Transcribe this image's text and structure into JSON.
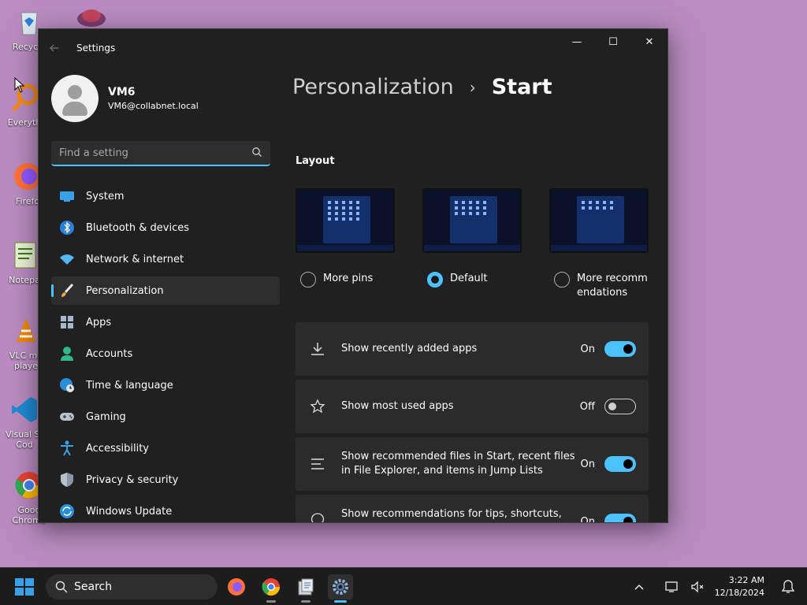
{
  "desktop": {
    "icons": [
      {
        "label": "Recycle",
        "name": "recycle-bin"
      },
      {
        "label": "Everyth",
        "name": "everything"
      },
      {
        "label": "Firefo",
        "name": "firefox"
      },
      {
        "label": "Notepa",
        "name": "notepad"
      },
      {
        "label": "VLC ma",
        "name": "vlc"
      },
      {
        "label": "Visual St",
        "name": "vscode"
      },
      {
        "label": "Goog",
        "name": "chrome"
      }
    ],
    "extra_labels": {
      "vlc_line2": "playe",
      "vscode_line2": "Cod",
      "chrome_line2": "Chrome"
    }
  },
  "window": {
    "title": "Settings",
    "back_icon": "arrow-left-icon",
    "controls": {
      "minimize": "—",
      "maximize": "☐",
      "close": "✕"
    }
  },
  "profile": {
    "name": "VM6",
    "email": "VM6@collabnet.local"
  },
  "search": {
    "placeholder": "Find a setting"
  },
  "nav": {
    "items": [
      {
        "label": "System",
        "icon": "monitor-icon"
      },
      {
        "label": "Bluetooth & devices",
        "icon": "bluetooth-icon"
      },
      {
        "label": "Network & internet",
        "icon": "wifi-icon"
      },
      {
        "label": "Personalization",
        "icon": "brush-icon",
        "active": true
      },
      {
        "label": "Apps",
        "icon": "apps-icon"
      },
      {
        "label": "Accounts",
        "icon": "person-icon"
      },
      {
        "label": "Time & language",
        "icon": "globe-clock-icon"
      },
      {
        "label": "Gaming",
        "icon": "gamepad-icon"
      },
      {
        "label": "Accessibility",
        "icon": "accessibility-icon"
      },
      {
        "label": "Privacy & security",
        "icon": "shield-icon"
      },
      {
        "label": "Windows Update",
        "icon": "update-icon"
      }
    ]
  },
  "content": {
    "breadcrumb_parent": "Personalization",
    "breadcrumb_separator": "›",
    "breadcrumb_current": "Start",
    "section_label": "Layout",
    "layout_options": [
      {
        "label": "More pins",
        "checked": false
      },
      {
        "label": "Default",
        "checked": true
      },
      {
        "label": "More recommendations",
        "checked": false
      }
    ],
    "settings": [
      {
        "label": "Show recently added apps",
        "state": "On",
        "on": true,
        "icon": "download-icon"
      },
      {
        "label": "Show most used apps",
        "state": "Off",
        "on": false,
        "icon": "star-icon"
      },
      {
        "label": "Show recommended files in Start, recent files in File Explorer, and items in Jump Lists",
        "state": "On",
        "on": true,
        "icon": "list-icon"
      },
      {
        "label": "Show recommendations for tips, shortcuts, new apps, and more",
        "state": "On",
        "on": true,
        "icon": "lightbulb-icon"
      }
    ]
  },
  "taskbar": {
    "search_label": "Search",
    "apps": [
      {
        "name": "firefox"
      },
      {
        "name": "chrome"
      },
      {
        "name": "file-manager"
      },
      {
        "name": "settings",
        "active": true
      }
    ],
    "time": "3:22 AM",
    "date": "12/18/2024"
  },
  "colors": {
    "accent": "#4cc2ff",
    "desktop": "#b98bc0",
    "window_bg": "#202020",
    "card_bg": "#2b2b2b"
  }
}
